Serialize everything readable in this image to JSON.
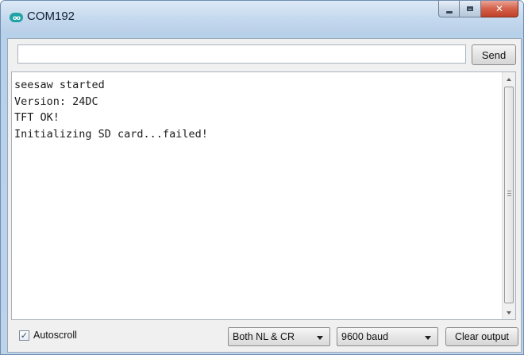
{
  "window": {
    "title": "COM192",
    "app_icon": "arduino-icon",
    "controls": {
      "minimize": "minimize-icon",
      "maximize": "maximize-icon",
      "close": "close-icon"
    }
  },
  "send_bar": {
    "input_value": "",
    "send_label": "Send"
  },
  "monitor": {
    "lines": [
      "seesaw started",
      "Version: 24DC",
      "TFT OK!",
      "Initializing SD card...failed!"
    ]
  },
  "bottom_bar": {
    "autoscroll_label": "Autoscroll",
    "autoscroll_checked": true,
    "line_ending_selected": "Both NL & CR",
    "baud_selected": "9600 baud",
    "clear_label": "Clear output"
  }
}
